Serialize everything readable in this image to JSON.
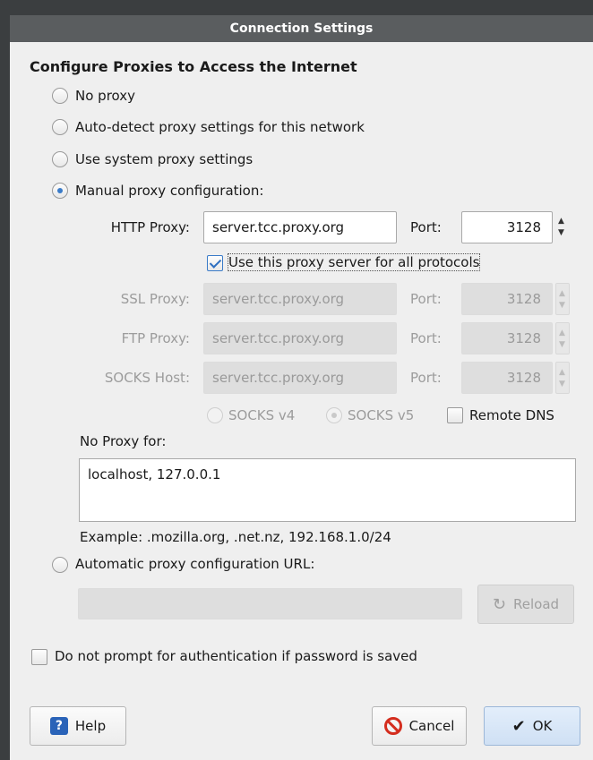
{
  "window": {
    "title": "Connection Settings"
  },
  "heading": "Configure Proxies to Access the Internet",
  "proxy_modes": {
    "no_proxy": "No proxy",
    "auto_detect": "Auto-detect proxy settings for this network",
    "system": "Use system proxy settings",
    "manual": "Manual proxy configuration:",
    "auto_url": "Automatic proxy configuration URL:"
  },
  "selected_mode": "manual",
  "http": {
    "label": "HTTP Proxy:",
    "host": "server.tcc.proxy.org",
    "port_label": "Port:",
    "port": "3128"
  },
  "all_protocols": {
    "label": "Use this proxy server for all protocols",
    "checked": true
  },
  "ssl": {
    "label": "SSL Proxy:",
    "host": "server.tcc.proxy.org",
    "port_label": "Port:",
    "port": "3128"
  },
  "ftp": {
    "label": "FTP Proxy:",
    "host": "server.tcc.proxy.org",
    "port_label": "Port:",
    "port": "3128"
  },
  "socks": {
    "label": "SOCKS Host:",
    "host": "server.tcc.proxy.org",
    "port_label": "Port:",
    "port": "3128",
    "v4": "SOCKS v4",
    "v5": "SOCKS v5",
    "remote_dns": "Remote DNS"
  },
  "no_proxy_for": {
    "label": "No Proxy for:",
    "value": "localhost, 127.0.0.1",
    "example": "Example: .mozilla.org, .net.nz, 192.168.1.0/24"
  },
  "auto_url": {
    "value": "",
    "reload": "Reload"
  },
  "auth_prompt": "Do not prompt for authentication if password is saved",
  "buttons": {
    "help": "Help",
    "cancel": "Cancel",
    "ok": "OK"
  },
  "colors": {
    "accent": "#3a7bc8",
    "titlebar": "#5a5d5f",
    "cancel_icon": "#d42d1e"
  }
}
